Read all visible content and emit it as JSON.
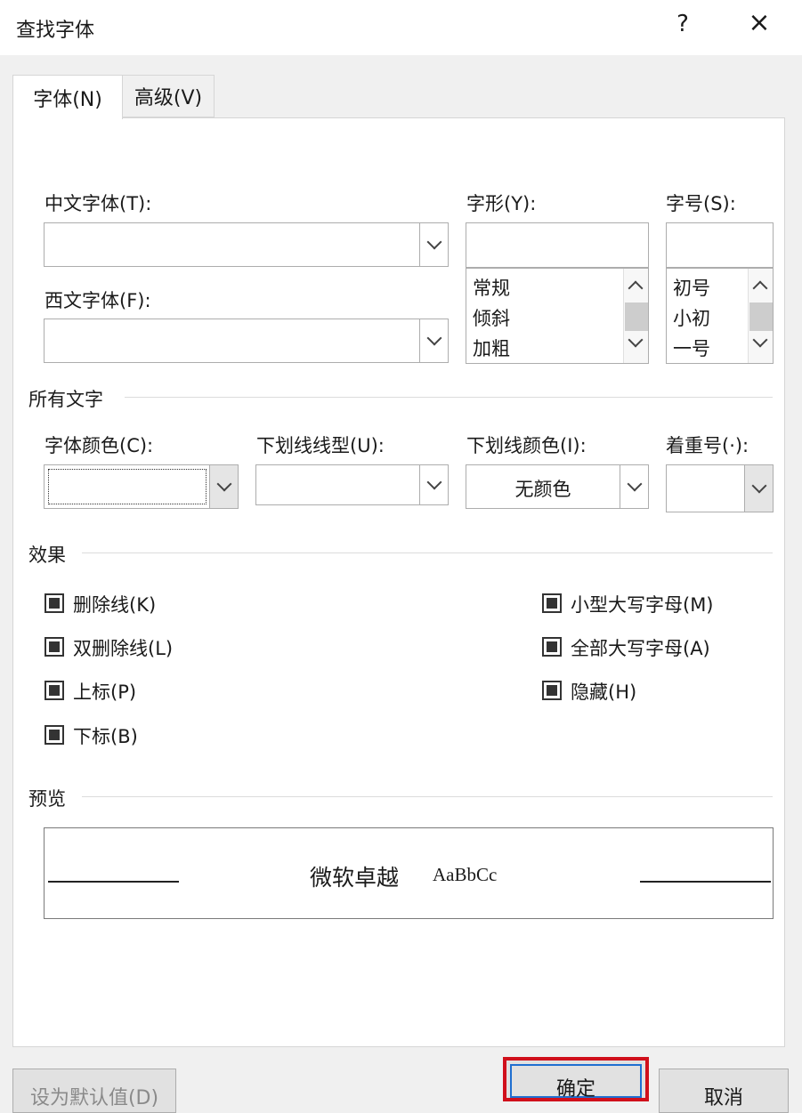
{
  "window": {
    "title": "查找字体",
    "help_glyph": "?",
    "close_glyph": "×"
  },
  "tabs": [
    {
      "label": "字体(N)"
    },
    {
      "label": "高级(V)"
    }
  ],
  "font": {
    "chinese_label": "中文字体(T):",
    "chinese_value": "",
    "western_label": "西文字体(F):",
    "western_value": "",
    "style_label": "字形(Y):",
    "style_value": "",
    "style_options": [
      "常规",
      "倾斜",
      "加粗"
    ],
    "size_label": "字号(S):",
    "size_value": "",
    "size_options": [
      "初号",
      "小初",
      "一号"
    ]
  },
  "all_text": {
    "group_title": "所有文字",
    "font_color_label": "字体颜色(C):",
    "font_color_value": "",
    "underline_style_label": "下划线线型(U):",
    "underline_style_value": "",
    "underline_color_label": "下划线颜色(I):",
    "underline_color_value": "无颜色",
    "emphasis_label": "着重号(·):",
    "emphasis_value": ""
  },
  "effects": {
    "group_title": "效果",
    "left": [
      "删除线(K)",
      "双删除线(L)",
      "上标(P)",
      "下标(B)"
    ],
    "right": [
      "小型大写字母(M)",
      "全部大写字母(A)",
      "隐藏(H)"
    ]
  },
  "preview": {
    "group_title": "预览",
    "sample_cn": "微软卓越",
    "sample_en": "AaBbCc"
  },
  "buttons": {
    "default_label": "设为默认值(D)",
    "ok_label": "确定",
    "cancel_label": "取消"
  },
  "colors": {
    "highlight_border": "#d0101b",
    "focus_border": "#1f6fd1"
  },
  "icons": [
    "chevron-down-icon",
    "chevron-up-icon",
    "close-icon",
    "help-icon",
    "checkbox-indeterminate-icon"
  ]
}
